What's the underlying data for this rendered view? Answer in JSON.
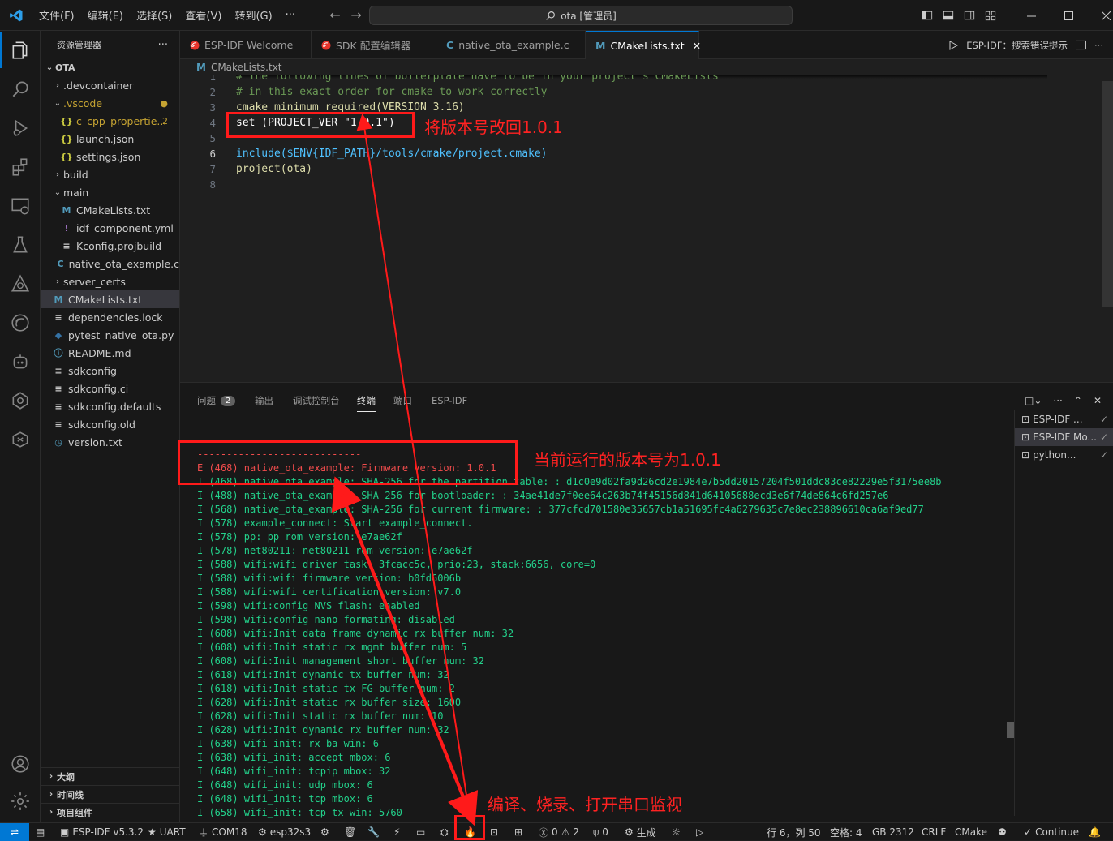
{
  "titlebar": {
    "menus": [
      "文件(F)",
      "编辑(E)",
      "选择(S)",
      "查看(V)",
      "转到(G)",
      "···"
    ],
    "search": "ota [管理员]"
  },
  "sidebar": {
    "title": "资源管理器",
    "more": "···",
    "root": "OTA",
    "items": [
      {
        "label": ".devcontainer",
        "chev": "›",
        "icon": "",
        "extra": ""
      },
      {
        "label": ".vscode",
        "chev": "⌄",
        "icon": "",
        "extra": "●"
      },
      {
        "label": "c_cpp_propertie...",
        "chev": "",
        "icon": "{}",
        "extra": "2"
      },
      {
        "label": "launch.json",
        "chev": "",
        "icon": "{}",
        "extra": ""
      },
      {
        "label": "settings.json",
        "chev": "",
        "icon": "{}",
        "extra": ""
      },
      {
        "label": "build",
        "chev": "›",
        "icon": "",
        "extra": ""
      },
      {
        "label": "main",
        "chev": "⌄",
        "icon": "",
        "extra": ""
      },
      {
        "label": "CMakeLists.txt",
        "chev": "",
        "icon": "M",
        "extra": ""
      },
      {
        "label": "idf_component.yml",
        "chev": "",
        "icon": "!",
        "extra": ""
      },
      {
        "label": "Kconfig.projbuild",
        "chev": "",
        "icon": "≡",
        "extra": ""
      },
      {
        "label": "native_ota_example.c",
        "chev": "",
        "icon": "C",
        "extra": ""
      },
      {
        "label": "server_certs",
        "chev": "›",
        "icon": "",
        "extra": ""
      },
      {
        "label": "CMakeLists.txt",
        "chev": "",
        "icon": "M",
        "extra": ""
      },
      {
        "label": "dependencies.lock",
        "chev": "",
        "icon": "≡",
        "extra": ""
      },
      {
        "label": "pytest_native_ota.py",
        "chev": "",
        "icon": "◆",
        "extra": ""
      },
      {
        "label": "README.md",
        "chev": "",
        "icon": "ⓘ",
        "extra": ""
      },
      {
        "label": "sdkconfig",
        "chev": "",
        "icon": "≡",
        "extra": ""
      },
      {
        "label": "sdkconfig.ci",
        "chev": "",
        "icon": "≡",
        "extra": ""
      },
      {
        "label": "sdkconfig.defaults",
        "chev": "",
        "icon": "≡",
        "extra": ""
      },
      {
        "label": "sdkconfig.old",
        "chev": "",
        "icon": "≡",
        "extra": ""
      },
      {
        "label": "version.txt",
        "chev": "",
        "icon": "◷",
        "extra": ""
      }
    ],
    "sections": [
      "大纲",
      "时间线",
      "项目组件"
    ]
  },
  "tabs": [
    {
      "label": "ESP-IDF Welcome",
      "icon": "esp"
    },
    {
      "label": "SDK 配置编辑器",
      "icon": "esp"
    },
    {
      "label": "native_ota_example.c",
      "icon": "C"
    },
    {
      "label": "CMakeLists.txt",
      "icon": "M"
    }
  ],
  "tabbar_right": "ESP-IDF：搜索错误提示",
  "breadcrumb": "CMakeLists.txt",
  "editor": {
    "lines": [
      {
        "n": "1",
        "text": "# The following lines of boilerplate have to be in your project's CMakeLists"
      },
      {
        "n": "2",
        "text": "# in this exact order for cmake to work correctly"
      },
      {
        "n": "3",
        "text": "cmake_minimum_required(VERSION 3.16)"
      },
      {
        "n": "4",
        "text": "set (PROJECT_VER \"1.0.1\")"
      },
      {
        "n": "5",
        "text": ""
      },
      {
        "n": "6",
        "text": "include($ENV{IDF_PATH}/tools/cmake/project.cmake)"
      },
      {
        "n": "7",
        "text": "project(ota)"
      },
      {
        "n": "8",
        "text": ""
      }
    ]
  },
  "panel": {
    "tabs": [
      "问题",
      "输出",
      "调试控制台",
      "终端",
      "端口",
      "ESP-IDF"
    ],
    "problems_count": "2",
    "terminal_lines": [
      "----------------------------",
      "E (468) native_ota_example: Firmware version: 1.0.1",
      "I (468) native_ota_example: SHA-256 for the partition table: : d1c0e9d02fa9d26cd2e1984e7b5dd20157204f501ddc83ce82229e5f3175ee8b",
      "I (488) native_ota_example: SHA-256 for bootloader: : 34ae41de7f0ee64c263b74f45156d841d64105688ecd3e6f74de864c6fd257e6",
      "I (568) native_ota_example: SHA-256 for current firmware: : 377cfcd701580e35657cb1a51695fc4a6279635c7e8ec238896610ca6af9ed77",
      "I (578) example_connect: Start example_connect.",
      "I (578) pp: pp rom version: e7ae62f",
      "I (578) net80211: net80211 rom version: e7ae62f",
      "I (588) wifi:wifi driver task: 3fcacc5c, prio:23, stack:6656, core=0",
      "I (588) wifi:wifi firmware version: b0fd6006b",
      "I (588) wifi:wifi certification version: v7.0",
      "I (598) wifi:config NVS flash: enabled",
      "I (598) wifi:config nano formating: disabled",
      "I (608) wifi:Init data frame dynamic rx buffer num: 32",
      "I (608) wifi:Init static rx mgmt buffer num: 5",
      "I (608) wifi:Init management short buffer num: 32",
      "I (618) wifi:Init dynamic tx buffer num: 32",
      "I (618) wifi:Init static tx FG buffer num: 2",
      "I (628) wifi:Init static rx buffer size: 1600",
      "I (628) wifi:Init static rx buffer num: 10",
      "I (628) wifi:Init dynamic rx buffer num: 32",
      "I (638) wifi_init: rx ba win: 6",
      "I (638) wifi_init: accept mbox: 6",
      "I (648) wifi_init: tcpip mbox: 32",
      "I (648) wifi_init: udp mbox: 6",
      "I (648) wifi_init: tcp mbox: 6",
      "I (658) wifi_init: tcp tx win: 5760"
    ],
    "terminals": [
      {
        "label": "ESP-IDF ...",
        "check": "✓"
      },
      {
        "label": "ESP-IDF Mo...",
        "check": "✓"
      },
      {
        "label": "python...",
        "check": "✓"
      }
    ]
  },
  "statusbar": {
    "idf": "ESP-IDF v5.3.2",
    "uart": "UART",
    "com": "COM18",
    "target": "esp32s3",
    "errors": "0",
    "warnings": "2",
    "ports": "0",
    "build": "生成",
    "position": "行 6，列 50",
    "spaces": "空格: 4",
    "encoding": "GB 2312",
    "eol": "CRLF",
    "lang": "CMake",
    "continue": "Continue"
  },
  "annotations": {
    "version_note": "将版本号改回1.0.1",
    "running_note": "当前运行的版本号为1.0.1",
    "build_note": "编译、烧录、打开串口监视"
  },
  "colors": {
    "accent": "#0078d4",
    "annotation_red": "#ff1a1a",
    "terminal_green": "#23d18b",
    "terminal_red": "#f14c4c"
  }
}
